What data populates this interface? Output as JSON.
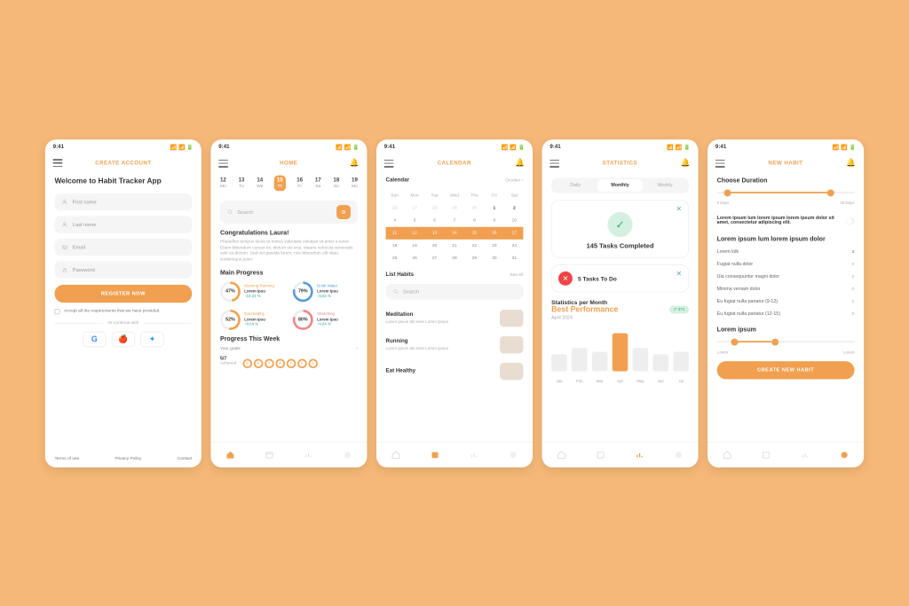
{
  "statusBar": {
    "time": "9:41",
    "sig": "📶 📶 🔋"
  },
  "screen1": {
    "title": "CREATE ACCOUNT",
    "h1": "Welcome to Habit Tracker App",
    "fn": "First name",
    "ln": "Last name",
    "em": "Email",
    "pw": "Password",
    "btn": "REGISTER NOW",
    "chk": "Accept all the requirements that we have provided.",
    "div": "Or continue with",
    "tou": "Terms of use",
    "pp": "Privacy Policy",
    "ct": "Contact"
  },
  "screen2": {
    "title": "HOME",
    "search": "Search",
    "cong": "Congratulations Laura!",
    "desc": "Phasellus tempus lacus et metus vulputate volutpat sit amet a tortor. Etiam bibendum cursus ex, dictum vel erat. Mauris vehicula venenatis velit eu dictum. Sed vel gravida lorem, non bibendum elit vitae, scelerisque justo.",
    "mp": "Main Progress",
    "p1l": "Morning Running",
    "p1v": "Lorem Ipsu",
    "p1c": "↑10,24 %",
    "p2l": "Drink Water",
    "p2v": "Lorem Ipsu",
    "p2c": "↑9,64 %",
    "p3l": "Eat Healthy",
    "p3v": "Lorem Ipsu",
    "p3c": "↑9,64 %",
    "p4l": "Stretching",
    "p4v": "Lorem Ipsu",
    "p4c": "↑9,64 %",
    "ptw": "Progress This Week",
    "yg": "Your goals",
    "ach": "5/7",
    "achl": "Achieved",
    "days": [
      {
        "n": "12",
        "d": "Mo"
      },
      {
        "n": "13",
        "d": "Tu"
      },
      {
        "n": "14",
        "d": "We"
      },
      {
        "n": "15",
        "d": "Th"
      },
      {
        "n": "16",
        "d": "Fr"
      },
      {
        "n": "17",
        "d": "Sa"
      },
      {
        "n": "18",
        "d": "Su"
      },
      {
        "n": "19",
        "d": "Mo"
      }
    ]
  },
  "screen3": {
    "title": "CALENDAR",
    "cal": "Calendar",
    "mon": "October",
    "lh": "List Habits",
    "sa": "See All",
    "search": "Search",
    "h1": "Meditation",
    "h1d": "Lorem Ipsum Ids lerim Lorem Ipsum",
    "h2": "Running",
    "h2d": "Lorem Ipsum Ids lerim Lorem Ipsum",
    "h3": "Eat Healthy"
  },
  "screen4": {
    "title": "STATISTICS",
    "t1": "Daily",
    "t2": "Monthly",
    "t3": "Weekly",
    "done": "145 Tasks Completed",
    "todo": "5 Tasks To Do",
    "spm": "Statistics per Month",
    "bp": "Best Performance",
    "mon": "April 2024",
    "badge": "↗ 371",
    "months": [
      "Jan",
      "Feb",
      "Mar",
      "Apr",
      "May",
      "Jun",
      "Jul"
    ]
  },
  "screen5": {
    "title": "NEW HABIT",
    "cd": "Choose Duration",
    "d0": "0 Days",
    "d30": "30 Days",
    "t1": "Lorem ipsum lum lorem ipsum lorem ipsum dolor sit amet, consectetur adipiscing elit.",
    "t2": "Lorem ipsum lum lorem ipsum dolor",
    "r1": "Lorem lolk",
    "r2": "Fugiat nulla dolor",
    "r3": "Ula consequuntur magni dolor",
    "r4": "Minima veniam dolor",
    "r5": "Eu fugiat nulla pariatur (9-12)",
    "r6": "Eu fugiat nulla pariatur (12-15)",
    "li": "Lorem ipsum",
    "sl": "Lorem",
    "btn": "CREATE NEW HABIT"
  },
  "chart_data": {
    "type": "bar",
    "title": "Statistics per Month — Best Performance",
    "categories": [
      "Jan",
      "Feb",
      "Mar",
      "Apr",
      "May",
      "Jun",
      "Jul"
    ],
    "values": [
      40,
      55,
      45,
      90,
      55,
      40,
      45
    ],
    "highlight_index": 3,
    "ylim": [
      0,
      100
    ]
  }
}
